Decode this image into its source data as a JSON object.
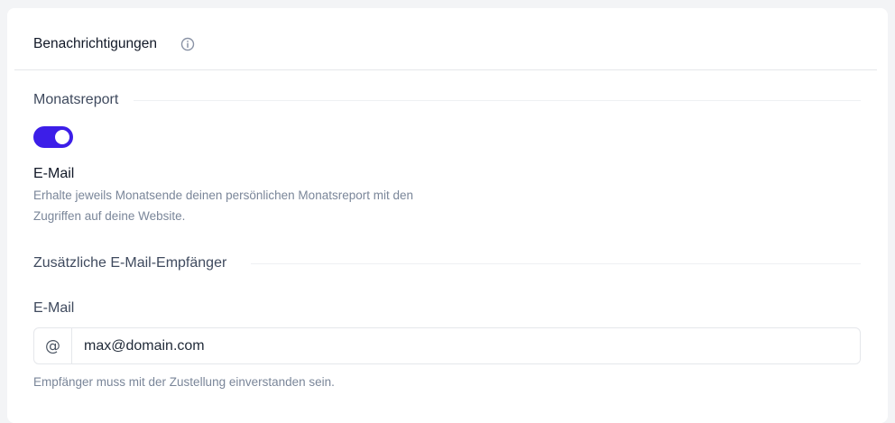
{
  "header": {
    "title": "Benachrichtigungen",
    "info_icon": "info-circle-icon"
  },
  "monthly_report": {
    "section_title": "Monatsreport",
    "toggle_on": true,
    "label": "E-Mail",
    "description": "Erhalte jeweils Monatsende deinen persönlichen Monatsreport mit den Zugriffen auf deine Website."
  },
  "recipients": {
    "section_title": "Zusätzliche E-Mail-Empfänger",
    "field_label": "E-Mail",
    "addon_symbol": "@",
    "input_value": "max@domain.com",
    "help_text": "Empfänger muss mit der Zustellung einverstanden sein."
  },
  "colors": {
    "accent": "#3c1ee8",
    "card_bg": "#ffffff",
    "page_bg": "#f3f4f6",
    "muted_text": "#7a8699"
  }
}
